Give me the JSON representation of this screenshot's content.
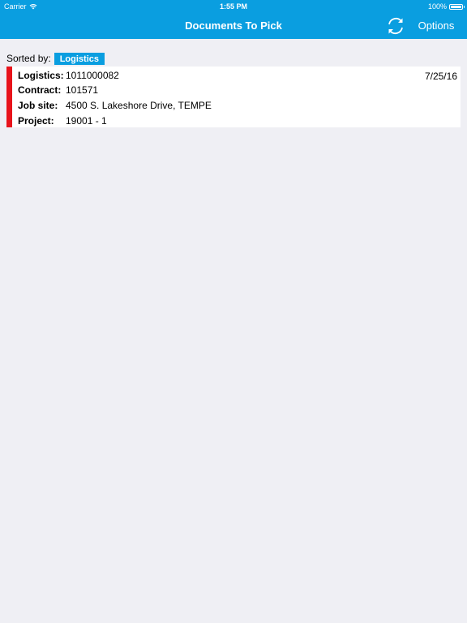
{
  "status_bar": {
    "carrier": "Carrier",
    "time": "1:55 PM",
    "battery": "100%",
    "icons": [
      "wifi-icon",
      "battery-icon"
    ]
  },
  "nav": {
    "title": "Documents To Pick",
    "options_label": "Options",
    "refresh_icon": "refresh-icon"
  },
  "sort": {
    "label": "Sorted by:",
    "value": "Logistics"
  },
  "documents": [
    {
      "logistics_label": "Logistics:",
      "logistics": "1011000082",
      "contract_label": "Contract:",
      "contract": "101571",
      "job_site_label": "Job site:",
      "job_site": "4500 S. Lakeshore Drive, TEMPE",
      "project_label": "Project:",
      "project": "19001 - 1",
      "date": "7/25/16",
      "status_color": "#e8131b"
    }
  ],
  "colors": {
    "accent": "#0a9ee0",
    "background": "#efeff4",
    "status_red": "#e8131b"
  }
}
